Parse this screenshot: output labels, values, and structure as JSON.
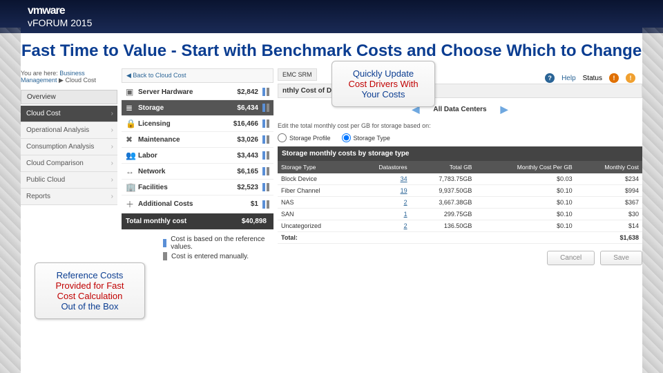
{
  "banner": {
    "brand": "vmware",
    "event": "vFORUM 2015"
  },
  "title": "Fast Time to Value - Start with Benchmark Costs and Choose Which to Change",
  "callouts": {
    "top": {
      "l1": "Quickly Update",
      "l2": "Cost Drivers With",
      "l3": "Your Costs"
    },
    "bottom": {
      "l1": "Reference Costs",
      "l2": "Provided for Fast",
      "l3": "Cost Calculation",
      "l4": "Out of the Box"
    }
  },
  "breadcrumb": {
    "prefix": "You are here:",
    "a": "Business Management",
    "b": "Cloud Cost"
  },
  "nav": {
    "overview": "Overview",
    "items": [
      "Cloud Cost",
      "Operational Analysis",
      "Consumption Analysis",
      "Cloud Comparison",
      "Public Cloud",
      "Reports"
    ],
    "active": 0
  },
  "back": "◀ Back to Cloud Cost",
  "costs": [
    {
      "icon": "▣",
      "label": "Server Hardware",
      "value": "$2,842"
    },
    {
      "icon": "≣",
      "label": "Storage",
      "value": "$6,434",
      "selected": true
    },
    {
      "icon": "🔒",
      "label": "Licensing",
      "value": "$16,466"
    },
    {
      "icon": "✖",
      "label": "Maintenance",
      "value": "$3,026"
    },
    {
      "icon": "👥",
      "label": "Labor",
      "value": "$3,443"
    },
    {
      "icon": "↔",
      "label": "Network",
      "value": "$6,165"
    },
    {
      "icon": "🏢",
      "label": "Facilities",
      "value": "$2,523"
    },
    {
      "icon": "＋",
      "label": "Additional Costs",
      "value": "$1"
    }
  ],
  "total": {
    "label": "Total monthly cost",
    "value": "$40,898"
  },
  "detail": {
    "srm": "EMC SRM",
    "title": "nthly Cost of Datastores",
    "dc": "All Data Centers",
    "edit": "Edit the total monthly cost per GB for storage based on:",
    "radios": {
      "a": "Storage Profile",
      "b": "Storage Type"
    },
    "table_title": "Storage monthly costs by storage type",
    "cols": [
      "Storage Type",
      "Datastores",
      "Total GB",
      "Monthly Cost Per GB",
      "Monthly Cost"
    ],
    "rows": [
      {
        "t": "Block Device",
        "d": "34",
        "g": "7,783.75GB",
        "p": "$0.03",
        "m": "$234"
      },
      {
        "t": "Fiber Channel",
        "d": "19",
        "g": "9,937.50GB",
        "p": "$0.10",
        "m": "$994"
      },
      {
        "t": "NAS",
        "d": "2",
        "g": "3,667.38GB",
        "p": "$0.10",
        "m": "$367"
      },
      {
        "t": "SAN",
        "d": "1",
        "g": "299.75GB",
        "p": "$0.10",
        "m": "$30"
      },
      {
        "t": "Uncategorized",
        "d": "2",
        "g": "136.50GB",
        "p": "$0.10",
        "m": "$14"
      }
    ],
    "total_label": "Total:",
    "total_val": "$1,638",
    "cancel": "Cancel",
    "save": "Save"
  },
  "legend": {
    "a": "Cost is based on the reference values.",
    "b": "Cost is entered manually."
  },
  "help": {
    "help": "Help",
    "status": "Status"
  }
}
